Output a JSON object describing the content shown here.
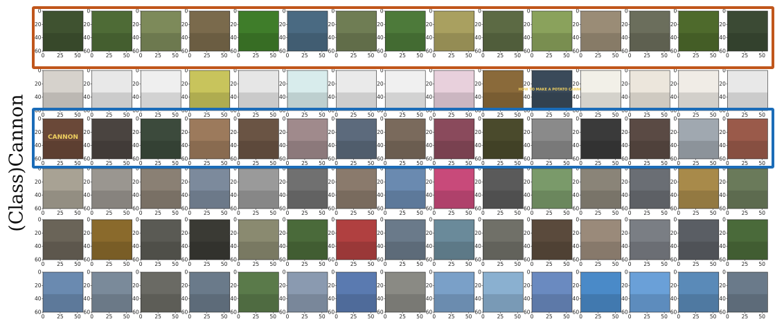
{
  "row_label": "(Class)Cannon",
  "tick_values": {
    "x": [
      "0",
      "25",
      "50"
    ],
    "y": [
      "0",
      "20",
      "40",
      "60"
    ]
  },
  "highlight_colors": {
    "row_1": "#c0561b",
    "row_3": "#1b6cb8"
  },
  "rows": [
    {
      "thumbnails": [
        {
          "color": "#3f5230"
        },
        {
          "color": "#4e6b36"
        },
        {
          "color": "#7d8a5a"
        },
        {
          "color": "#7a6a4c"
        },
        {
          "color": "#3f7d2a"
        },
        {
          "color": "#4a6a82"
        },
        {
          "color": "#6f7d54"
        },
        {
          "color": "#4d7a3a"
        },
        {
          "color": "#a9a060"
        },
        {
          "color": "#5c6a44"
        },
        {
          "color": "#8aa25c"
        },
        {
          "color": "#9a8c76"
        },
        {
          "color": "#6b6e5c"
        },
        {
          "color": "#4e6a2c"
        },
        {
          "color": "#3b4a34"
        }
      ]
    },
    {
      "thumbnails": [
        {
          "color": "#d6d2cc"
        },
        {
          "color": "#e8e8e8"
        },
        {
          "color": "#efefef"
        },
        {
          "color": "#c8c45c"
        },
        {
          "color": "#e6e6e6"
        },
        {
          "color": "#d8ecec"
        },
        {
          "color": "#eaeaea"
        },
        {
          "color": "#f0f0f0"
        },
        {
          "color": "#e8d0dc"
        },
        {
          "color": "#8a6a3a"
        },
        {
          "color": "#3a4a5a",
          "text": "HOW TO MAKE A POTATO CANNON"
        },
        {
          "color": "#f2f0e8"
        },
        {
          "color": "#ece6dc"
        },
        {
          "color": "#f0ece6"
        },
        {
          "color": "#e8e8e8"
        }
      ]
    },
    {
      "thumbnails": [
        {
          "color": "#6a4838",
          "text": "CANNON"
        },
        {
          "color": "#4a4440"
        },
        {
          "color": "#3c4a3c"
        },
        {
          "color": "#9c7a5c"
        },
        {
          "color": "#6a5444"
        },
        {
          "color": "#a08a8c"
        },
        {
          "color": "#5c6a7c"
        },
        {
          "color": "#7a6a5c"
        },
        {
          "color": "#8a4a5c"
        },
        {
          "color": "#4a4a2c"
        },
        {
          "color": "#8a8a8a"
        },
        {
          "color": "#3a3a3a"
        },
        {
          "color": "#5a4a44"
        },
        {
          "color": "#a0a8b0"
        },
        {
          "color": "#9a5a4a"
        }
      ]
    },
    {
      "thumbnails": [
        {
          "color": "#a8a294"
        },
        {
          "color": "#9a9690"
        },
        {
          "color": "#8a8074"
        },
        {
          "color": "#7c8a9c"
        },
        {
          "color": "#9a9a9a"
        },
        {
          "color": "#707070"
        },
        {
          "color": "#8a7a6c"
        },
        {
          "color": "#6a8ab0"
        },
        {
          "color": "#c84a7a"
        },
        {
          "color": "#5a5a5a"
        },
        {
          "color": "#7a9a6a"
        },
        {
          "color": "#8a8478"
        },
        {
          "color": "#6a6e74"
        },
        {
          "color": "#a88a4a"
        },
        {
          "color": "#6a7a5a"
        }
      ]
    },
    {
      "thumbnails": [
        {
          "color": "#6a6458"
        },
        {
          "color": "#8a6a2c"
        },
        {
          "color": "#5a5a54"
        },
        {
          "color": "#3a3a34"
        },
        {
          "color": "#8a8a70"
        },
        {
          "color": "#4a6a3a"
        },
        {
          "color": "#b04040"
        },
        {
          "color": "#6a7a8a"
        },
        {
          "color": "#6a8a9a"
        },
        {
          "color": "#707068"
        },
        {
          "color": "#5a4a3c"
        },
        {
          "color": "#9a8a7a"
        },
        {
          "color": "#7a7e84"
        },
        {
          "color": "#5a5e64"
        },
        {
          "color": "#4a6a3a"
        }
      ]
    },
    {
      "thumbnails": [
        {
          "color": "#6a8ab0"
        },
        {
          "color": "#7a8a9a"
        },
        {
          "color": "#6a6a64"
        },
        {
          "color": "#6a7a8a"
        },
        {
          "color": "#5a7a4a"
        },
        {
          "color": "#8a9ab0"
        },
        {
          "color": "#5a7ab0"
        },
        {
          "color": "#8a8a84"
        },
        {
          "color": "#7aa0c8"
        },
        {
          "color": "#8ab0d0"
        },
        {
          "color": "#6a8ac0"
        },
        {
          "color": "#4a8ac8"
        },
        {
          "color": "#6aa0d8"
        },
        {
          "color": "#5a8ab8"
        },
        {
          "color": "#6a7a8a"
        }
      ]
    }
  ]
}
